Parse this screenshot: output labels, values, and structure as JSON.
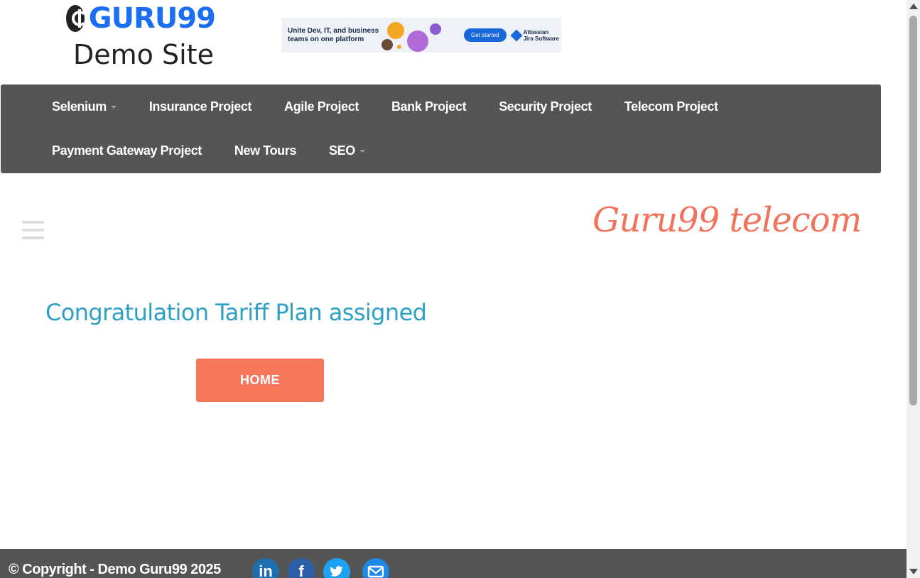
{
  "header": {
    "logo_text": "GURU99",
    "logo_subtitle": "Demo Site",
    "logo_icon": "guru99-logo-icon"
  },
  "ad": {
    "copy": "Unite Dev, IT, and business teams on one platform",
    "button": "Get started",
    "brand_line1": "Atlassian",
    "brand_line2": "Jira Software"
  },
  "nav": {
    "row1": [
      "Selenium",
      "Insurance Project",
      "Agile Project",
      "Bank Project",
      "Security Project",
      "Telecom Project"
    ],
    "row2": [
      "Payment Gateway Project",
      "New Tours",
      "SEO"
    ]
  },
  "main": {
    "brand": "Guru99 telecom",
    "message": "Congratulation Tariff Plan assigned",
    "home_button": "HOME"
  },
  "footer": {
    "copyright": "© Copyright - Demo Guru99 2025",
    "social": [
      "linkedin-icon",
      "facebook-icon",
      "twitter-icon",
      "email-icon"
    ]
  },
  "colors": {
    "nav_bg": "#555555",
    "accent": "#f7775d",
    "message": "#2ea0c4",
    "logo_blue": "#1b6ff2"
  }
}
